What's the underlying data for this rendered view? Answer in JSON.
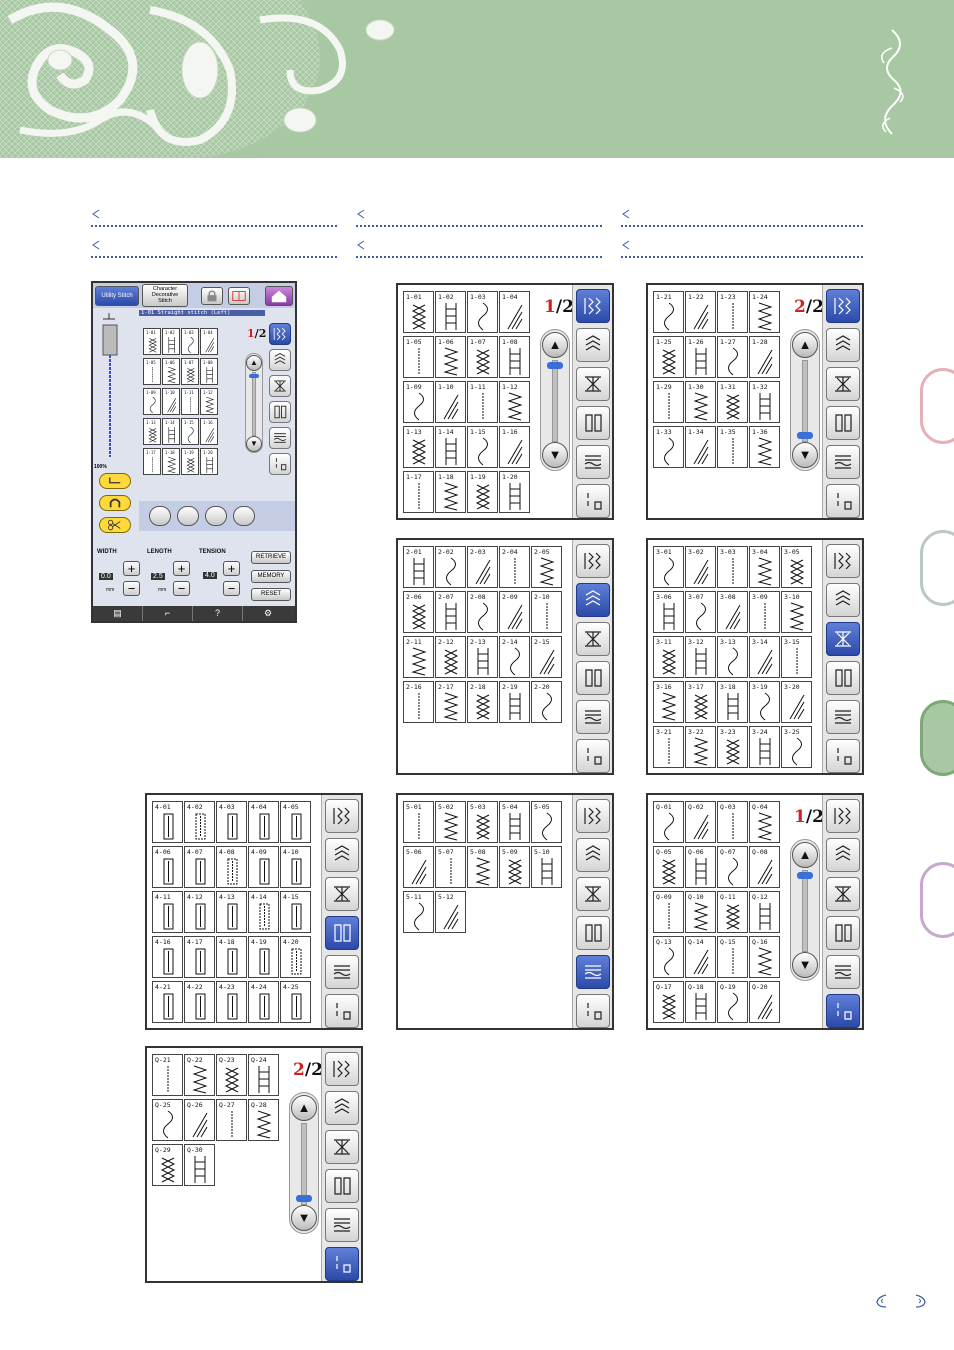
{
  "colors": {
    "header": "#a8c8a4",
    "accent": "#3a5fa0",
    "active_tab": "#3a5cc0",
    "page_num": "#d02020"
  },
  "icons": [
    "lace-ornament",
    "flourish-ornament",
    "dotted-separator",
    "page-corner-icon"
  ],
  "machine": {
    "tab_utility": "Utility Stitch",
    "tab_character": "Character\nDecorative\nStitch",
    "stitch_name": "1-01  Straight stitch (Left)",
    "page_num": "1",
    "page_den": "2",
    "zoom": "100%",
    "width_label": "WIDTH",
    "length_label": "LENGTH",
    "tension_label": "TENSION",
    "width_value": "0.0",
    "length_value": "2.5",
    "tension_value": "4.0",
    "unit_mm": "mm",
    "unit_mm2": "mm",
    "retrieve": "RETRIEVE",
    "memory": "MEMORY",
    "reset": "RESET",
    "help": "?",
    "minicells": [
      "1-01",
      "1-02",
      "1-03",
      "1-04",
      "1-05",
      "1-06",
      "1-07",
      "1-08",
      "1-09",
      "1-10",
      "1-11",
      "1-12",
      "1-13",
      "1-14",
      "1-15",
      "1-16",
      "1-17",
      "1-18",
      "1-19",
      "1-20"
    ]
  },
  "panels": [
    {
      "id": "p1",
      "page_num": "1",
      "page_den": "2",
      "active": 0,
      "cells": [
        "1-01",
        "1-02",
        "1-03",
        "1-04",
        "1-05",
        "1-06",
        "1-07",
        "1-08",
        "1-09",
        "1-10",
        "1-11",
        "1-12",
        "1-13",
        "1-14",
        "1-15",
        "1-16",
        "1-17",
        "1-18",
        "1-19",
        "1-20"
      ]
    },
    {
      "id": "p2",
      "page_num": "2",
      "page_den": "2",
      "active": 0,
      "cells": [
        "1-21",
        "1-22",
        "1-23",
        "1-24",
        "1-25",
        "1-26",
        "1-27",
        "1-28",
        "1-29",
        "1-30",
        "1-31",
        "1-32",
        "1-33",
        "1-34",
        "1-35",
        "1-36"
      ]
    },
    {
      "id": "p3",
      "active": 1,
      "cells": [
        "2-01",
        "2-02",
        "2-03",
        "2-04",
        "2-05",
        "2-06",
        "2-07",
        "2-08",
        "2-09",
        "2-10",
        "2-11",
        "2-12",
        "2-13",
        "2-14",
        "2-15",
        "2-16",
        "2-17",
        "2-18",
        "2-19",
        "2-20"
      ]
    },
    {
      "id": "p4",
      "active": 2,
      "cells": [
        "3-01",
        "3-02",
        "3-03",
        "3-04",
        "3-05",
        "3-06",
        "3-07",
        "3-08",
        "3-09",
        "3-10",
        "3-11",
        "3-12",
        "3-13",
        "3-14",
        "3-15",
        "3-16",
        "3-17",
        "3-18",
        "3-19",
        "3-20",
        "3-21",
        "3-22",
        "3-23",
        "3-24",
        "3-25"
      ]
    },
    {
      "id": "p5",
      "active": 3,
      "cells": [
        "4-01",
        "4-02",
        "4-03",
        "4-04",
        "4-05",
        "4-06",
        "4-07",
        "4-08",
        "4-09",
        "4-10",
        "4-11",
        "4-12",
        "4-13",
        "4-14",
        "4-15",
        "4-16",
        "4-17",
        "4-18",
        "4-19",
        "4-20",
        "4-21",
        "4-22",
        "4-23",
        "4-24",
        "4-25"
      ]
    },
    {
      "id": "p6",
      "active": 4,
      "cells": [
        "5-01",
        "5-02",
        "5-03",
        "5-04",
        "5-05",
        "5-06",
        "5-07",
        "5-08",
        "5-09",
        "5-10",
        "5-11",
        "5-12"
      ]
    },
    {
      "id": "p7",
      "page_num": "1",
      "page_den": "2",
      "active": 5,
      "cells": [
        "Q-01",
        "Q-02",
        "Q-03",
        "Q-04",
        "Q-05",
        "Q-06",
        "Q-07",
        "Q-08",
        "Q-09",
        "Q-10",
        "Q-11",
        "Q-12",
        "Q-13",
        "Q-14",
        "Q-15",
        "Q-16",
        "Q-17",
        "Q-18",
        "Q-19",
        "Q-20"
      ]
    },
    {
      "id": "p8",
      "page_num": "2",
      "page_den": "2",
      "active": 5,
      "cells": [
        "Q-21",
        "Q-22",
        "Q-23",
        "Q-24",
        "Q-25",
        "Q-26",
        "Q-27",
        "Q-28",
        "Q-29",
        "Q-30"
      ]
    }
  ]
}
